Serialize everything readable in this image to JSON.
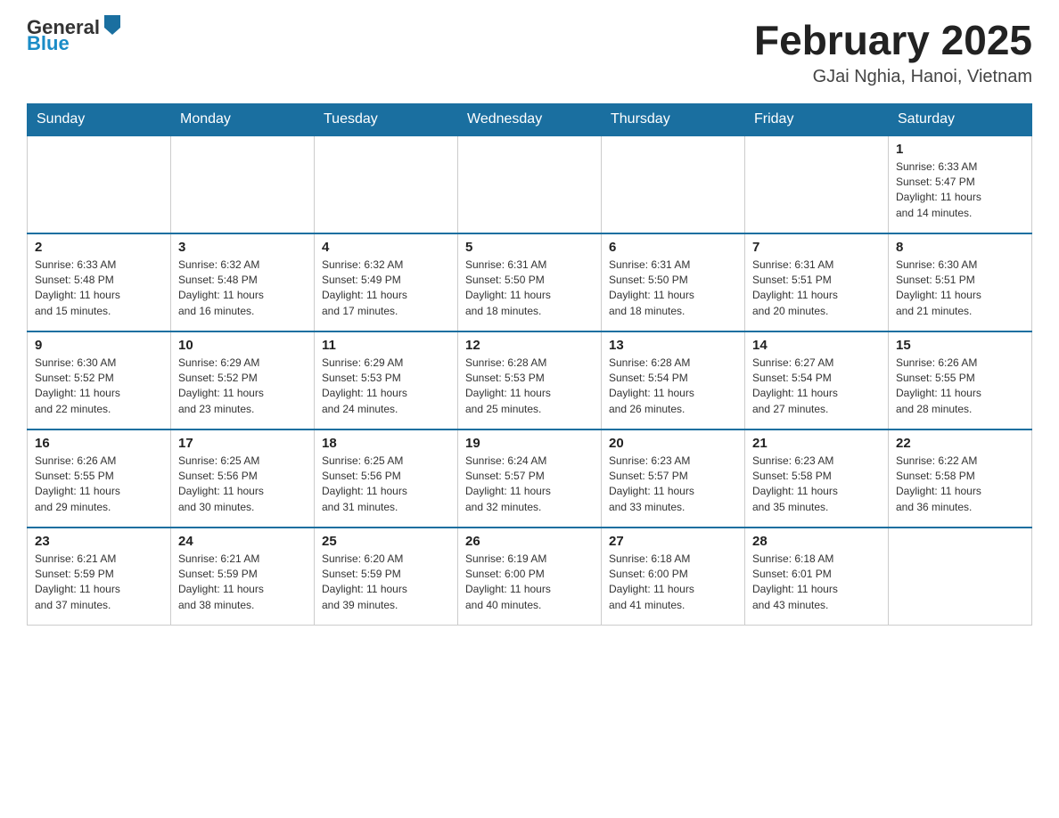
{
  "header": {
    "month_title": "February 2025",
    "location": "GJai Nghia, Hanoi, Vietnam",
    "logo_general": "General",
    "logo_blue": "Blue"
  },
  "days_of_week": [
    "Sunday",
    "Monday",
    "Tuesday",
    "Wednesday",
    "Thursday",
    "Friday",
    "Saturday"
  ],
  "weeks": [
    [
      {
        "day": "",
        "info": ""
      },
      {
        "day": "",
        "info": ""
      },
      {
        "day": "",
        "info": ""
      },
      {
        "day": "",
        "info": ""
      },
      {
        "day": "",
        "info": ""
      },
      {
        "day": "",
        "info": ""
      },
      {
        "day": "1",
        "info": "Sunrise: 6:33 AM\nSunset: 5:47 PM\nDaylight: 11 hours\nand 14 minutes."
      }
    ],
    [
      {
        "day": "2",
        "info": "Sunrise: 6:33 AM\nSunset: 5:48 PM\nDaylight: 11 hours\nand 15 minutes."
      },
      {
        "day": "3",
        "info": "Sunrise: 6:32 AM\nSunset: 5:48 PM\nDaylight: 11 hours\nand 16 minutes."
      },
      {
        "day": "4",
        "info": "Sunrise: 6:32 AM\nSunset: 5:49 PM\nDaylight: 11 hours\nand 17 minutes."
      },
      {
        "day": "5",
        "info": "Sunrise: 6:31 AM\nSunset: 5:50 PM\nDaylight: 11 hours\nand 18 minutes."
      },
      {
        "day": "6",
        "info": "Sunrise: 6:31 AM\nSunset: 5:50 PM\nDaylight: 11 hours\nand 18 minutes."
      },
      {
        "day": "7",
        "info": "Sunrise: 6:31 AM\nSunset: 5:51 PM\nDaylight: 11 hours\nand 20 minutes."
      },
      {
        "day": "8",
        "info": "Sunrise: 6:30 AM\nSunset: 5:51 PM\nDaylight: 11 hours\nand 21 minutes."
      }
    ],
    [
      {
        "day": "9",
        "info": "Sunrise: 6:30 AM\nSunset: 5:52 PM\nDaylight: 11 hours\nand 22 minutes."
      },
      {
        "day": "10",
        "info": "Sunrise: 6:29 AM\nSunset: 5:52 PM\nDaylight: 11 hours\nand 23 minutes."
      },
      {
        "day": "11",
        "info": "Sunrise: 6:29 AM\nSunset: 5:53 PM\nDaylight: 11 hours\nand 24 minutes."
      },
      {
        "day": "12",
        "info": "Sunrise: 6:28 AM\nSunset: 5:53 PM\nDaylight: 11 hours\nand 25 minutes."
      },
      {
        "day": "13",
        "info": "Sunrise: 6:28 AM\nSunset: 5:54 PM\nDaylight: 11 hours\nand 26 minutes."
      },
      {
        "day": "14",
        "info": "Sunrise: 6:27 AM\nSunset: 5:54 PM\nDaylight: 11 hours\nand 27 minutes."
      },
      {
        "day": "15",
        "info": "Sunrise: 6:26 AM\nSunset: 5:55 PM\nDaylight: 11 hours\nand 28 minutes."
      }
    ],
    [
      {
        "day": "16",
        "info": "Sunrise: 6:26 AM\nSunset: 5:55 PM\nDaylight: 11 hours\nand 29 minutes."
      },
      {
        "day": "17",
        "info": "Sunrise: 6:25 AM\nSunset: 5:56 PM\nDaylight: 11 hours\nand 30 minutes."
      },
      {
        "day": "18",
        "info": "Sunrise: 6:25 AM\nSunset: 5:56 PM\nDaylight: 11 hours\nand 31 minutes."
      },
      {
        "day": "19",
        "info": "Sunrise: 6:24 AM\nSunset: 5:57 PM\nDaylight: 11 hours\nand 32 minutes."
      },
      {
        "day": "20",
        "info": "Sunrise: 6:23 AM\nSunset: 5:57 PM\nDaylight: 11 hours\nand 33 minutes."
      },
      {
        "day": "21",
        "info": "Sunrise: 6:23 AM\nSunset: 5:58 PM\nDaylight: 11 hours\nand 35 minutes."
      },
      {
        "day": "22",
        "info": "Sunrise: 6:22 AM\nSunset: 5:58 PM\nDaylight: 11 hours\nand 36 minutes."
      }
    ],
    [
      {
        "day": "23",
        "info": "Sunrise: 6:21 AM\nSunset: 5:59 PM\nDaylight: 11 hours\nand 37 minutes."
      },
      {
        "day": "24",
        "info": "Sunrise: 6:21 AM\nSunset: 5:59 PM\nDaylight: 11 hours\nand 38 minutes."
      },
      {
        "day": "25",
        "info": "Sunrise: 6:20 AM\nSunset: 5:59 PM\nDaylight: 11 hours\nand 39 minutes."
      },
      {
        "day": "26",
        "info": "Sunrise: 6:19 AM\nSunset: 6:00 PM\nDaylight: 11 hours\nand 40 minutes."
      },
      {
        "day": "27",
        "info": "Sunrise: 6:18 AM\nSunset: 6:00 PM\nDaylight: 11 hours\nand 41 minutes."
      },
      {
        "day": "28",
        "info": "Sunrise: 6:18 AM\nSunset: 6:01 PM\nDaylight: 11 hours\nand 43 minutes."
      },
      {
        "day": "",
        "info": ""
      }
    ]
  ]
}
